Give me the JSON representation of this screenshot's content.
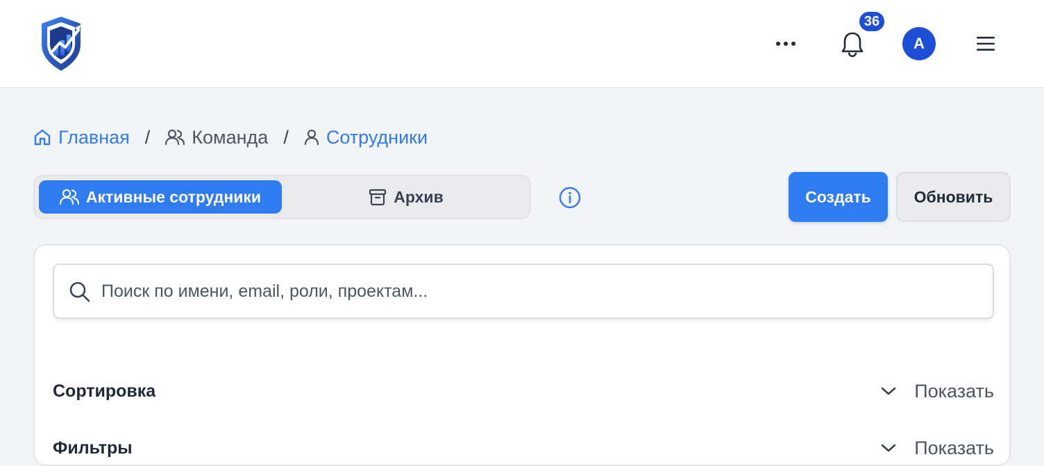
{
  "header": {
    "notifications_count": "36",
    "avatar_initial": "A"
  },
  "breadcrumb": {
    "home": "Главная",
    "team": "Команда",
    "employees": "Сотрудники"
  },
  "tabs": {
    "active": "Активные сотрудники",
    "archive": "Архив"
  },
  "actions": {
    "create": "Создать",
    "refresh": "Обновить"
  },
  "search": {
    "placeholder": "Поиск по имени, email, роли, проектам..."
  },
  "sections": {
    "sort": {
      "title": "Сортировка",
      "toggle": "Показать"
    },
    "filters": {
      "title": "Фильтры",
      "toggle": "Показать"
    }
  },
  "colors": {
    "accent": "#2f7bf0",
    "badge": "#1d4ed8",
    "background": "#f3f4f6"
  }
}
